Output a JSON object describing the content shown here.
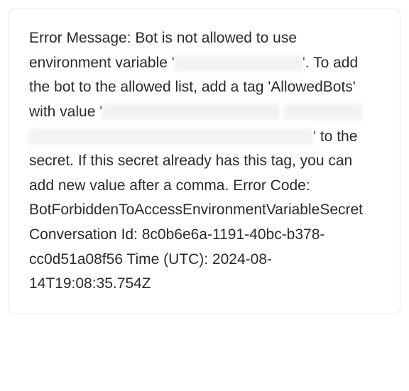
{
  "error": {
    "text_part_1": "Error Message: Bot is not allowed to use environment variable '",
    "text_part_2": "'. To add the bot to the allowed list, add a tag 'AllowedBots' with value '",
    "text_part_3": "' to the secret. If this secret already has this tag, you can add new value after a comma. Error Code: BotForbiddenToAccessEnvironmentVariableSecret Conversation Id: 8c0b6e6a-1191-40bc-b378-cc0d51a08f56 Time (UTC): 2024-08-14T19:08:35.754Z"
  }
}
